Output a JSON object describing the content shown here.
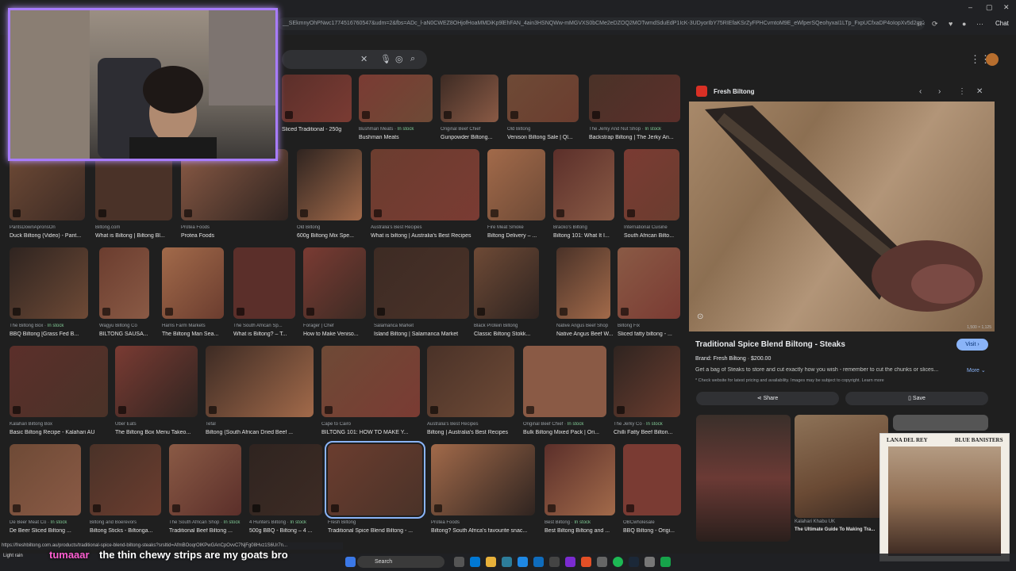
{
  "browser": {
    "url": "__SEkmnyOhPNwc1774516760547&udm=2&fbs=ADc_l-aN0CWEZ8OHjofHoaMMDiKp9lEhFAN_4ain3HSNQWw-mMGVXS0bCMe2eDZOQ2MOTwmdSduEdP1IcK-3UDyorIbY75RIEfaKSrZyFPHCvmtoM9E_eWlperSQeohyxaI1LTp_FxpUCfxaDP4oIopXv5d2gz241cj...",
    "chat_label": "Chat"
  },
  "search": {
    "clear_icon": "close-icon",
    "voice_icon": "mic-icon",
    "lens_icon": "lens-icon",
    "search_icon": "search-icon"
  },
  "grid": {
    "row0": [
      {
        "source": "",
        "caption": "Sliced Traditional - 250g",
        "stock": ""
      },
      {
        "source": "Bushman Meats · ",
        "stock": "In stock",
        "caption": "Bushman Meats"
      },
      {
        "source": "Original Beef Chief",
        "stock": "",
        "caption": "Gunpowder Biltong..."
      },
      {
        "source": "Old Biltong",
        "stock": "",
        "caption": "Venison Biltong Sale | Ql..."
      },
      {
        "source": "The Jerky And Nut Shop · ",
        "stock": "In stock",
        "caption": "Backstrap Biltong | The Jerky An..."
      }
    ],
    "row1": [
      {
        "source": "PantsDownApronsOn",
        "stock": "",
        "caption": "Duck Biltong (Video) - Pant..."
      },
      {
        "source": "Biltong.com",
        "stock": "",
        "caption": "What is Biltong | Biltong Bl..."
      },
      {
        "source": "Protea Foods",
        "stock": "",
        "caption": "Protea Foods"
      },
      {
        "source": "Old Biltong",
        "stock": "",
        "caption": "600g Biltong Mix Spe..."
      },
      {
        "source": "Australia's Best Recipes",
        "stock": "",
        "caption": "What is biltong | Australia's Best Recipes"
      },
      {
        "source": "Fire Meat Smoke",
        "stock": "",
        "caption": "Biltong Delivery – ..."
      },
      {
        "source": "Bracko's Biltong",
        "stock": "",
        "caption": "Biltong 101: What It I..."
      },
      {
        "source": "International Cuisine",
        "stock": "",
        "caption": "South African Bilto..."
      }
    ],
    "row2": [
      {
        "source": "The Biltong Box · ",
        "stock": "In stock",
        "caption": "BBQ Biltong [Grass Fed B..."
      },
      {
        "source": "Wagyu Biltong Co",
        "stock": "",
        "caption": "BILTONG SAUSA..."
      },
      {
        "source": "Harris Farm Markets",
        "stock": "",
        "caption": "The Biltong Man Sea..."
      },
      {
        "source": "The South African Sp...",
        "stock": "",
        "caption": "What is Biltong? – T..."
      },
      {
        "source": "Forager | Chef",
        "stock": "",
        "caption": "How to Make Veniso..."
      },
      {
        "source": "Salamanca Market",
        "stock": "",
        "caption": "Island Biltong | Salamanca Market"
      },
      {
        "source": "Black Protein Biltong",
        "stock": "",
        "caption": "Classic Biltong Stokk..."
      },
      {
        "source": "Native Angus Beef Shop",
        "stock": "",
        "caption": "Native Angus Beef W..."
      },
      {
        "source": "Biltong Fix",
        "stock": "",
        "caption": "Sliced fatty biltong - ..."
      }
    ],
    "row3": [
      {
        "source": "Kalahari Biltong Box",
        "stock": "",
        "caption": "Basic Biltong Recipe - Kalahari AU"
      },
      {
        "source": "Uber Eats",
        "stock": "",
        "caption": "The Biltong Box Menu Takeo..."
      },
      {
        "source": "Tefal",
        "stock": "",
        "caption": "Biltong (South African Dried Beef ..."
      },
      {
        "source": "Cape to Cairo",
        "stock": "",
        "caption": "BILTONG 101: HOW TO MAKE Y..."
      },
      {
        "source": "Australia's Best Recipes",
        "stock": "",
        "caption": "Biltong | Australia's Best Recipes"
      },
      {
        "source": "Original Beef Chief · ",
        "stock": "In stock",
        "caption": "Bulk Biltong Mixed Pack | Ori..."
      },
      {
        "source": "The Jerky Co · ",
        "stock": "In stock",
        "caption": "Chilli Fatty Beef Bilton..."
      }
    ],
    "row4": [
      {
        "source": "De Beer Meat Co · ",
        "stock": "In stock",
        "caption": "De Beer Sliced Biltong ..."
      },
      {
        "source": "Biltong and Boerevors",
        "stock": "",
        "caption": "Biltong Sticks - Biltonga..."
      },
      {
        "source": "The South African Shop · ",
        "stock": "In stock",
        "caption": "Traditional Beef Biltong ..."
      },
      {
        "source": "4 Hunters Biltong · ",
        "stock": "In stock",
        "caption": "500g BBQ - Biltong – 4 ..."
      },
      {
        "source": "Fresh Biltong",
        "stock": "",
        "caption": "Traditional Spice Blend Biltong - ..."
      },
      {
        "source": "Protea Foods",
        "stock": "",
        "caption": "Biltong? South Africa's favourite snac..."
      },
      {
        "source": "Best Biltong · ",
        "stock": "In stock",
        "caption": "Best Biltong Biltong and ..."
      },
      {
        "source": "OBCwholesale",
        "stock": "",
        "caption": "BBQ Biltong - Origi..."
      }
    ]
  },
  "panel": {
    "source": "Fresh Biltong",
    "title": "Traditional Spice Blend Biltong - Steaks",
    "brand": "Brand: Fresh Biltong · $200.00",
    "description": "Get a bag of Steaks to store and cut exactly how you wish - remember to cut the chunks or slices...",
    "note": "* Check website for latest pricing and availability. Images may be subject to copyright. Learn more",
    "visit_label": "Visit",
    "more_label": "More",
    "share_label": "Share",
    "save_label": "Save",
    "image_size": "1,500 × 1,125",
    "related_source": "Kalahari Khabu UK",
    "related_caption": "The Ultimate Guide To Making Tra..."
  },
  "album": {
    "artist": "LANA DEL REY",
    "name": "BLUE BANISTERS"
  },
  "stream": {
    "chat_user": "tumaaar",
    "chat_message": "the thin chewy strips are my goats bro",
    "weather": "Light rain"
  },
  "status_url": "https://freshbiltong.com.au/products/traditional-spice-blend-biltong-steaks?srsltid=AfmBOoqrOIKPwGAnCpOvvC7NjFg08Hvz1S6Ur7n...",
  "taskbar": {
    "search_label": "Search"
  },
  "colors": {
    "accent": "#8ab4f8",
    "webcam_border": "#a87cff",
    "stock_green": "#81c995"
  }
}
